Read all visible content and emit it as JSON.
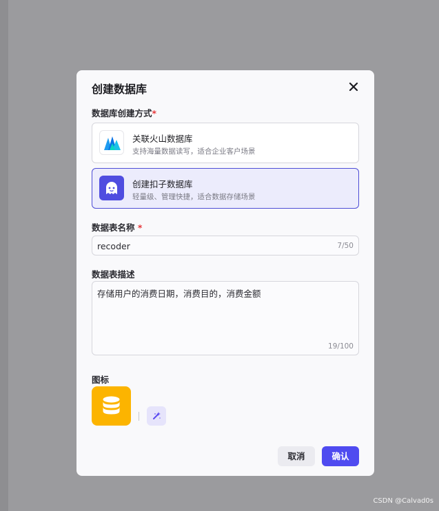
{
  "dialog": {
    "title": "创建数据库",
    "method_label": "数据库创建方式",
    "required_mark": "*",
    "options": [
      {
        "title": "关联火山数据库",
        "desc": "支持海量数据读写，适合企业客户场景",
        "icon": "volcano-icon"
      },
      {
        "title": "创建扣子数据库",
        "desc": "轻量级、管理快捷，适合数据存储场景",
        "icon": "coze-icon",
        "selected": true
      }
    ],
    "table_name_label": "数据表名称",
    "table_name_value": "recoder",
    "table_name_count": "7/50",
    "table_desc_label": "数据表描述",
    "table_desc_value": "存储用户的消费日期，消费目的，消费金额",
    "table_desc_count": "19/100",
    "icon_label": "图标",
    "cancel_label": "取消",
    "confirm_label": "确认"
  },
  "watermark": "CSDN @Calvad0s",
  "colors": {
    "accent": "#4f4bf0",
    "icon_tile": "#fcb400",
    "selected_bg": "#ececfc"
  }
}
